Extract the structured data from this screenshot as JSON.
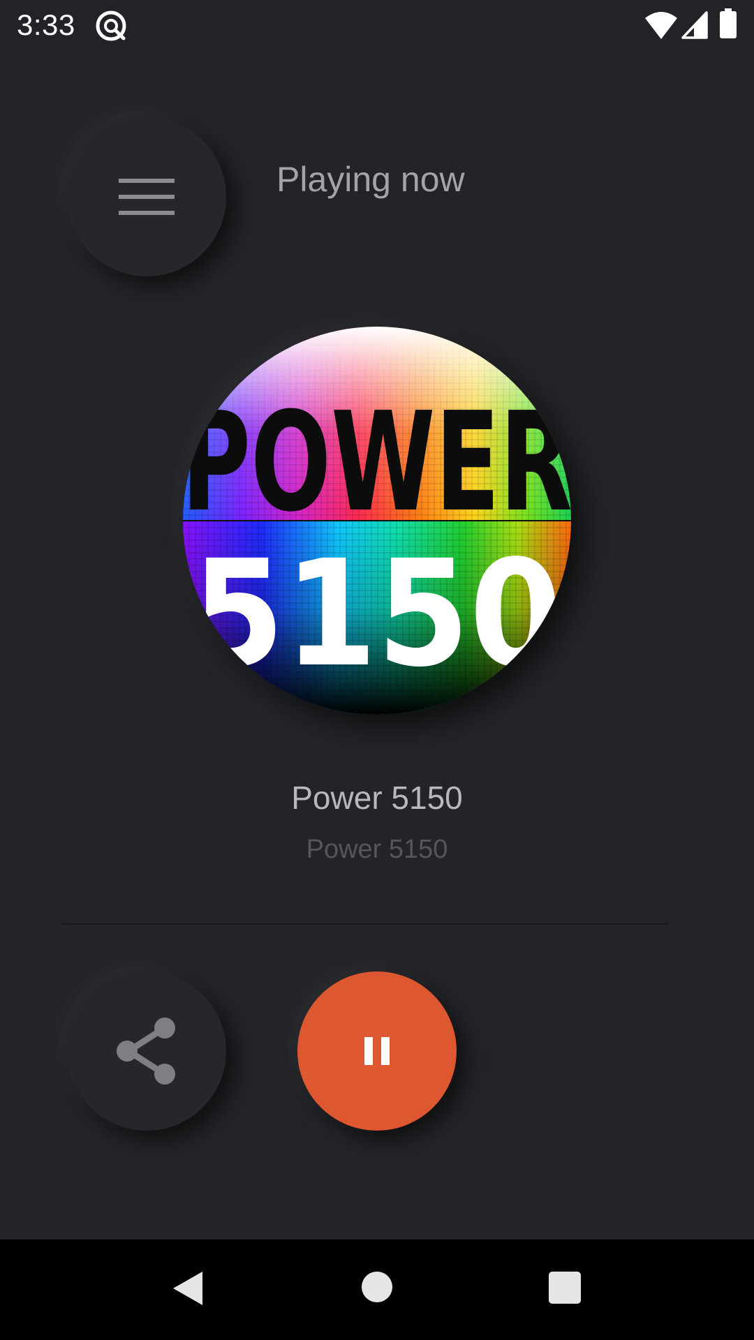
{
  "status_bar": {
    "time": "3:33",
    "icons": [
      "app-notification-icon",
      "wifi-icon",
      "cell-signal-icon",
      "battery-icon"
    ]
  },
  "header": {
    "menu_icon": "hamburger-menu-icon",
    "title": "Playing now"
  },
  "artwork": {
    "top_text": "POWER",
    "bottom_text": "5150"
  },
  "now_playing": {
    "station_name": "Power 5150",
    "station_subtitle": "Power 5150"
  },
  "controls": {
    "share_icon": "share-icon",
    "play_state_icon": "pause-icon"
  },
  "nav_bar": {
    "icons": [
      "back-icon",
      "home-icon",
      "recents-icon"
    ]
  },
  "colors": {
    "background": "#232428",
    "accent": "#dd5730",
    "title_text": "#a3a4a8",
    "subtitle_text": "#54565b"
  }
}
